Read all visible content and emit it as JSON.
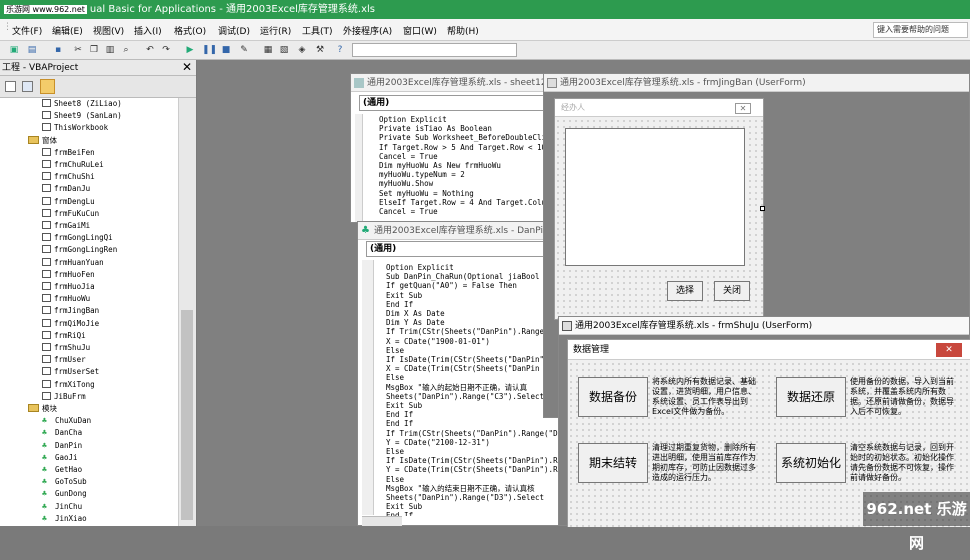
{
  "window": {
    "watermark": "乐游网 www.962.net",
    "title": "ual Basic for Applications - 通用2003Excel库存管理系统.xls"
  },
  "menu": {
    "items": [
      "文件(F)",
      "编辑(E)",
      "视图(V)",
      "插入(I)",
      "格式(O)",
      "调试(D)",
      "运行(R)",
      "工具(T)",
      "外接程序(A)",
      "窗口(W)",
      "帮助(H)"
    ],
    "help_placeholder": "键入需要帮助的问题"
  },
  "project": {
    "title": "工程 - VBAProject",
    "close": "✕",
    "tree": [
      {
        "kind": "sheet",
        "label": "Sheet8 (ZiLiao)",
        "indent": 3
      },
      {
        "kind": "sheet",
        "label": "Sheet9 (SanLan)",
        "indent": 3
      },
      {
        "kind": "sheet",
        "label": "ThisWorkbook",
        "indent": 3
      },
      {
        "kind": "folder",
        "label": "窗体",
        "indent": 2
      },
      {
        "kind": "form",
        "label": "frmBeiFen",
        "indent": 3
      },
      {
        "kind": "form",
        "label": "frmChuRuLei",
        "indent": 3
      },
      {
        "kind": "form",
        "label": "frmChuShi",
        "indent": 3
      },
      {
        "kind": "form",
        "label": "frmDanJu",
        "indent": 3
      },
      {
        "kind": "form",
        "label": "frmDengLu",
        "indent": 3
      },
      {
        "kind": "form",
        "label": "frmFuKuCun",
        "indent": 3
      },
      {
        "kind": "form",
        "label": "frmGaiMi",
        "indent": 3
      },
      {
        "kind": "form",
        "label": "frmGongLingQi",
        "indent": 3
      },
      {
        "kind": "form",
        "label": "frmGongLingRen",
        "indent": 3
      },
      {
        "kind": "form",
        "label": "frmHuanYuan",
        "indent": 3
      },
      {
        "kind": "form",
        "label": "frmHuoFen",
        "indent": 3
      },
      {
        "kind": "form",
        "label": "frmHuoJia",
        "indent": 3
      },
      {
        "kind": "form",
        "label": "frmHuoWu",
        "indent": 3
      },
      {
        "kind": "form",
        "label": "frmJingBan",
        "indent": 3
      },
      {
        "kind": "form",
        "label": "frmQiMoJie",
        "indent": 3
      },
      {
        "kind": "form",
        "label": "frmRiQi",
        "indent": 3
      },
      {
        "kind": "form",
        "label": "frmShuJu",
        "indent": 3
      },
      {
        "kind": "form",
        "label": "frmUser",
        "indent": 3
      },
      {
        "kind": "form",
        "label": "frmUserSet",
        "indent": 3
      },
      {
        "kind": "form",
        "label": "frmXiTong",
        "indent": 3
      },
      {
        "kind": "form",
        "label": "JiBuFrm",
        "indent": 3
      },
      {
        "kind": "folder",
        "label": "模块",
        "indent": 2
      },
      {
        "kind": "module",
        "label": "ChuXuDan",
        "indent": 3
      },
      {
        "kind": "module",
        "label": "DanCha",
        "indent": 3
      },
      {
        "kind": "module",
        "label": "DanPin",
        "indent": 3
      },
      {
        "kind": "module",
        "label": "GaoJi",
        "indent": 3
      },
      {
        "kind": "module",
        "label": "GetHao",
        "indent": 3
      },
      {
        "kind": "module",
        "label": "GoToSub",
        "indent": 3
      },
      {
        "kind": "module",
        "label": "GunDong",
        "indent": 3
      },
      {
        "kind": "module",
        "label": "JinChu",
        "indent": 3
      },
      {
        "kind": "module",
        "label": "JinXiao",
        "indent": 3
      }
    ]
  },
  "code_sheet12": {
    "title": "通用2003Excel库存管理系统.xls - sheet12",
    "combo": "(通用)",
    "lines": [
      "Option Explicit",
      "Private isTiao As Boolean",
      "Private Sub Worksheet_BeforeDoubleCli",
      "If Target.Row > 5 And Target.Row < 10",
      "Cancel = True",
      "Dim myHuoWu As New frmHuoWu",
      "myHuoWu.typeNum = 2",
      "myHuoWu.Show",
      "Set myHuoWu = Nothing",
      "ElseIf Target.Row = 4 And Target.Colu",
      "Cancel = True"
    ]
  },
  "code_danpin": {
    "title": "通用2003Excel库存管理系统.xls - DanPin",
    "combo": "(通用)",
    "lines": [
      "Option Explicit",
      "Sub DanPin_ChaRun(Optional jiaBool",
      "If getQuan(\"A0\") = False Then",
      "Exit Sub",
      "End If",
      "Dim X As Date",
      "Dim Y As Date",
      "If Trim(CStr(Sheets(\"DanPin\").Range",
      "X = CDate(\"1900-01-01\")",
      "Else",
      "If IsDate(Trim(CStr(Sheets(\"DanPin\"",
      "X = CDate(Trim(CStr(Sheets(\"DanPin",
      "Else",
      "MsgBox \"输入的起始日期不正确，请认真",
      "Sheets(\"DanPin\").Range(\"C3\").Select",
      "Exit Sub",
      "End If",
      "End If",
      "If Trim(CStr(Sheets(\"DanPin\").Range(\"D",
      "Y = CDate(\"2100-12-31\")",
      "Else",
      "If IsDate(Trim(CStr(Sheets(\"DanPin\").R",
      "Y = CDate(Trim(CStr(Sheets(\"DanPin\").R",
      "Else",
      "MsgBox \"输入的结束日期不正确，请认真核",
      "Sheets(\"DanPin\").Range(\"D3\").Select",
      "Exit Sub",
      "End If"
    ]
  },
  "form_jingban": {
    "title": "通用2003Excel库存管理系统.xls - frmJingBan (UserForm)",
    "caption": "经办人",
    "select": "选择",
    "close": "关闭"
  },
  "form_shuju": {
    "title": "通用2003Excel库存管理系统.xls - frmShuJu (UserForm)",
    "caption": "数据管理",
    "close": "✕",
    "backup": "数据备份",
    "backup_desc": "将系统内所有数据记录、基础设置，进货明细，用户信息、系统设置、员工作表导出到Excel文件做为备份。",
    "restore": "数据还原",
    "restore_desc": "使用备份的数据，导入到当前系统，并覆盖系统内所有数据。还原前请做备份，数据导入后不可恢复。",
    "period_end": "期末结转",
    "period_desc": "清理过期重复货物，删除所有进出明细，使用当前库存作为期初库存，可防止因数据过多造成的运行压力。",
    "init": "系统初始化",
    "init_desc": "清空系统数据与记录，回到开始时的初始状态。初始化操作请先备份数据不可恢复，操作前请做好备份。"
  },
  "badge": {
    "logo": "962.net 乐游网"
  }
}
